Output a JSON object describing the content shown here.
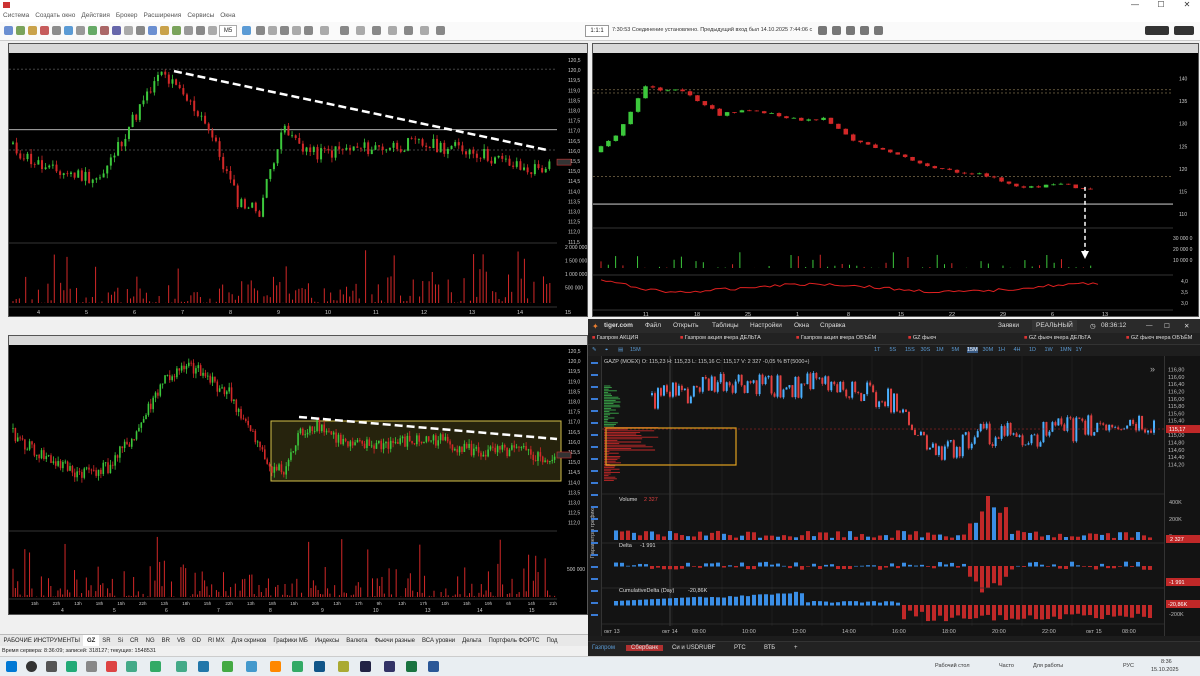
{
  "window": {
    "minimize": "—",
    "maximize": "☐",
    "close": "✕"
  },
  "menu": [
    "Система",
    "Создать окно",
    "Действия",
    "Брокер",
    "Расширения",
    "Сервисы",
    "Окна"
  ],
  "toolbar": {
    "interval": "M5",
    "frame": "1:1:1",
    "status_message": "7:30:53 Соединение установлено. Предыдущий вход был 14.10.2025 7:44:06 с"
  },
  "panes": {
    "pane1": {
      "y_ticks": [
        "120,5",
        "120,0",
        "119,5",
        "119,0",
        "118,5",
        "118,0",
        "117,5",
        "117,0",
        "116,5",
        "116,0",
        "115,5",
        "115,0",
        "114,5",
        "114,0",
        "113,5",
        "113,0",
        "112,5",
        "112,0",
        "111,5"
      ],
      "vol_ticks": [
        "2 000 000",
        "1 500 000",
        "1 000 000",
        "500 000"
      ],
      "x_ticks": [
        "4",
        "5",
        "6",
        "7",
        "8",
        "9",
        "10",
        "11",
        "12",
        "13",
        "14",
        "15"
      ]
    },
    "pane2": {
      "y_ticks": [
        "140",
        "135",
        "130",
        "125",
        "120",
        "115",
        "110"
      ],
      "vol_ticks": [
        "30 000 0",
        "20 000 0",
        "10 000 0"
      ],
      "ind_ticks": [
        "4,0",
        "3,5",
        "3,0"
      ],
      "x_ticks": [
        "11",
        "18",
        "25",
        "1",
        "8",
        "15",
        "22",
        "29",
        "6",
        "13"
      ]
    },
    "pane3": {
      "y_ticks": [
        "120,5",
        "120,0",
        "119,5",
        "119,0",
        "118,5",
        "118,0",
        "117,5",
        "117,0",
        "116,5",
        "116,0",
        "115,5",
        "115,0",
        "114,5",
        "114,0",
        "113,5",
        "113,0",
        "112,5",
        "112,0"
      ],
      "vol_ticks": [
        "500 000"
      ],
      "x_ticks": [
        "4",
        "5",
        "6",
        "7",
        "8",
        "9",
        "10",
        "13",
        "14",
        "15"
      ],
      "x_hours": [
        "15h",
        "22h",
        "13h",
        "18h",
        "15h",
        "22h",
        "13h",
        "18h",
        "15h",
        "22h",
        "13h",
        "18h",
        "15h",
        "20h",
        "13h",
        "17h",
        "9h",
        "13h",
        "17h",
        "10h",
        "15h",
        "19h",
        "6h",
        "14h",
        "21h"
      ]
    }
  },
  "quik_tabs": [
    "РАБОЧИЕ ИНСТРУМЕНТЫ",
    "GZ",
    "SR",
    "Si",
    "CR",
    "NG",
    "BR",
    "VB",
    "GD",
    "RI MX",
    "Для скринов",
    "Графики МБ",
    "Индексы",
    "Валюта",
    "Фьючи разные",
    "ВСА уровни",
    "Дельта",
    "Портфель ФОРТС",
    "Под"
  ],
  "quik_status": "Время сервера: 8:36:09; записей: 318127; текущих: 1548531",
  "tiger": {
    "brand": "tiger.com",
    "menu": [
      "Файл",
      "Открыть",
      "Таблицы",
      "Настройки",
      "Окна",
      "Справка"
    ],
    "orders_label": "Заявки",
    "mode_label": "РЕАЛЬНЫЙ",
    "time": "08:36:12",
    "tabs": [
      "Газпром АКЦИЯ",
      "Газпром акция вчера ДЕЛЬТА",
      "Газпром акция вчера ОБЪЁМ",
      "GZ фьюч",
      "GZ фьюч вчера ДЕЛЬТА",
      "GZ фьюч вчера ОБЪЁМ"
    ],
    "interval": "15M",
    "timeframes": [
      "1T",
      "5S",
      "15S",
      "30S",
      "1M",
      "5M",
      "15M",
      "30M",
      "1H",
      "4H",
      "1D",
      "1W",
      "1MN",
      "1Y"
    ],
    "quote": "GAZP (MOEX)  O: 115,23  H: 115,23  L: 115,16  C: 115,17  V: 2 327  -0,05 %   BT(5000+)",
    "price_ticks": [
      "116,80",
      "116,60",
      "116,40",
      "116,20",
      "116,00",
      "115,80",
      "115,60",
      "115,40",
      "115,20",
      "115,00",
      "114,80",
      "114,60",
      "114,40",
      "114,20"
    ],
    "last_price": "115,17",
    "volume_label": "Volume",
    "volume_value": "2 327",
    "volume_ticks": [
      "400K",
      "200K",
      "0"
    ],
    "volume_badge": "2 327",
    "delta_label": "Delta",
    "delta_value": "-1 991",
    "delta_badge": "-1 991",
    "cum_label": "CumulativeDelta (Day)",
    "cum_value": "-20,86K",
    "cum_ticks": [
      "-200K"
    ],
    "cum_badge": "-20,86K",
    "x_ticks": [
      "окт 13",
      "окт 14",
      "08:00",
      "10:00",
      "12:00",
      "14:00",
      "16:00",
      "18:00",
      "20:00",
      "22:00",
      "окт 15",
      "08:00"
    ],
    "side_caption": "Параметры графика",
    "bottom_tabs": [
      "Газпром",
      "Сбербанк",
      "Си и USDRUBF",
      "РТС",
      "ВТБ",
      "+"
    ]
  },
  "taskbar": {
    "desktop": "Рабочий стол",
    "clock": "Часто",
    "work": "Для работы",
    "lang": "РУС",
    "time": "8:36",
    "date": "15.10.2025"
  },
  "colors": {
    "bull": "#3cc83c",
    "bear": "#d22828",
    "tiger_up": "#3a8ee6",
    "tiger_down": "#d23232",
    "box": "#d4c04a"
  }
}
